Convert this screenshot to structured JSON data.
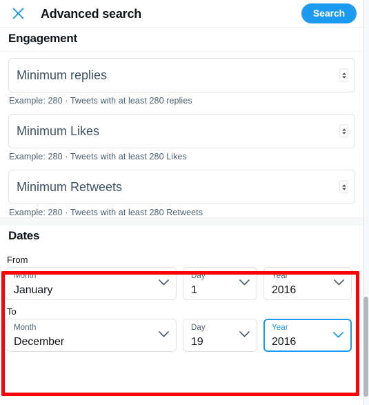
{
  "header": {
    "close_icon": "close-icon",
    "title": "Advanced search",
    "search_label": "Search",
    "accent_color": "#1D9BF0"
  },
  "engagement": {
    "section_title": "Engagement",
    "fields": [
      {
        "name": "minimum-replies",
        "placeholder": "Minimum replies",
        "value": "",
        "helper": "Example: 280 · Tweets with at least 280 replies"
      },
      {
        "name": "minimum-likes",
        "placeholder": "Minimum Likes",
        "value": "",
        "helper": "Example: 280 · Tweets with at least 280 Likes"
      },
      {
        "name": "minimum-retweets",
        "placeholder": "Minimum Retweets",
        "value": "",
        "helper": "Example: 280 · Tweets with at least 280 Retweets"
      }
    ]
  },
  "dates": {
    "section_title": "Dates",
    "from": {
      "direction_label": "From",
      "month": {
        "label": "Month",
        "value": "January"
      },
      "day": {
        "label": "Day",
        "value": "1"
      },
      "year": {
        "label": "Year",
        "value": "2016"
      }
    },
    "to": {
      "direction_label": "To",
      "month": {
        "label": "Month",
        "value": "December"
      },
      "day": {
        "label": "Day",
        "value": "19"
      },
      "year": {
        "label": "Year",
        "value": "2016",
        "focused": true
      }
    }
  },
  "annotation": {
    "name": "dates-highlight-box",
    "color": "#FE0000"
  },
  "scrollbar": {
    "name": "vertical-scrollbar",
    "thumb_color": "#B0B8BF"
  }
}
